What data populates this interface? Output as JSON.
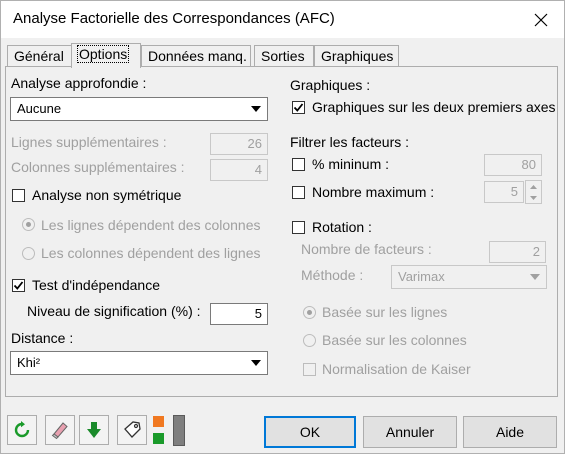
{
  "window": {
    "title": "Analyse Factorielle des Correspondances (AFC)"
  },
  "tabs": [
    {
      "label": "Général"
    },
    {
      "label": "Options",
      "active": true
    },
    {
      "label": "Données manq."
    },
    {
      "label": "Sorties"
    },
    {
      "label": "Graphiques"
    }
  ],
  "left": {
    "analyse_label": "Analyse approfondie :",
    "analyse_value": "Aucune",
    "lignes_sup_label": "Lignes supplémentaires :",
    "lignes_sup_value": "26",
    "colonnes_sup_label": "Colonnes supplémentaires :",
    "colonnes_sup_value": "4",
    "non_sym_label": "Analyse non symétrique",
    "radio_lignes": "Les lignes dépendent des colonnes",
    "radio_colonnes": "Les colonnes dépendent des lignes",
    "test_label": "Test d'indépendance",
    "niveau_label": "Niveau de signification (%) :",
    "niveau_value": "5",
    "distance_label": "Distance :",
    "distance_value": "Khi²"
  },
  "right": {
    "graphiques_label": "Graphiques :",
    "graphiques_check": "Graphiques sur les deux premiers axes",
    "filtrer_label": "Filtrer les facteurs :",
    "min_label": "% mininum :",
    "min_value": "80",
    "max_label": "Nombre maximum :",
    "max_value": "5",
    "rotation_label": "Rotation :",
    "nb_facteurs_label": "Nombre de facteurs :",
    "nb_facteurs_value": "2",
    "methode_label": "Méthode :",
    "methode_value": "Varimax",
    "radio_basee_lignes": "Basée sur les lignes",
    "radio_basee_colonnes": "Basée sur les colonnes",
    "kaiser_label": "Normalisation de Kaiser"
  },
  "buttons": {
    "ok": "OK",
    "annuler": "Annuler",
    "aide": "Aide"
  },
  "colors": {
    "accent": "#0078d7",
    "green": "#1a9a2a",
    "orange": "#f07820"
  }
}
